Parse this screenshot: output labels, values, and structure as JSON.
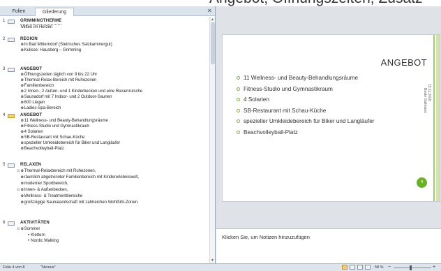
{
  "top_banner": {
    "text": "Angebot, Öffnungszeiten, Zusatz"
  },
  "left_tabs": [
    {
      "label": "Folien"
    },
    {
      "label": "Gliederung"
    }
  ],
  "outline": [
    {
      "num": "1",
      "title": "GRIMMINGTHERME",
      "lines": [
        {
          "text": "Mitten im Herzen",
          "type": "plain"
        }
      ]
    },
    {
      "num": "2",
      "title": "REGION",
      "lines": [
        {
          "text": "In Bad Mitterndorf (Steirisches Salzkammergut)",
          "type": "bullet"
        },
        {
          "text": "Kulisse: Hausberg – Grimming",
          "type": "bullet"
        }
      ]
    },
    {
      "num": "3",
      "title": "ANGEBOT",
      "lines": [
        {
          "text": "Öffnungszeiten  täglich von 9 bis 22 Uhr",
          "type": "bullet"
        },
        {
          "text": "Thermal-Relax-Bereich mit Ruhezonen",
          "type": "bullet"
        },
        {
          "text": "Familienbereich",
          "type": "bullet"
        },
        {
          "text": "2 Innen-, 2 Außen- und 1 Kinderbecken und eine Riesenrutsche",
          "type": "bullet"
        },
        {
          "text": "Saunadorf mit 7 Indoor- und 2 Outdoor-Saunen",
          "type": "bullet"
        },
        {
          "text": "600 Liegen",
          "type": "bullet"
        },
        {
          "text": "Ladies-Spa-Bereich",
          "type": "bullet"
        }
      ]
    },
    {
      "num": "4",
      "title": "ANGEBOT",
      "selected": true,
      "lines": [
        {
          "text": "11 Wellness- und Beauty-Behandlungsräume",
          "type": "bullet"
        },
        {
          "text": "Fitness-Studio und Gymnastikraum",
          "type": "bullet"
        },
        {
          "text": "4 Solarien",
          "type": "bullet"
        },
        {
          "text": "SB-Restaurant mit Schau-Küche",
          "type": "bullet"
        },
        {
          "text": "spezieller Umkleidebereich für Biker und Langläufer",
          "type": "bullet"
        },
        {
          "text": "Beachvolleyball-Platz",
          "type": "bullet"
        }
      ]
    },
    {
      "num": "5",
      "title": "RELAXEN",
      "lines": [
        {
          "text": "Thermal-Relaxbereich mit Ruhezonen,",
          "type": "bullet"
        },
        {
          "text": "räumlich abgetrennter  Familienbereich mit Kindererlebniswelt,",
          "type": "bullet"
        },
        {
          "text": "moderner Sportbereich,",
          "type": "bullet"
        },
        {
          "text": "Innen- & Außenbecken,",
          "type": "bullet"
        },
        {
          "text": "Wellness- & Treatmentbereiche",
          "type": "bullet"
        },
        {
          "text": "großzügige Saunalandschaft  mit zahlreichen Wohlfühl-Zonen.",
          "type": "bullet"
        }
      ]
    },
    {
      "num": "6",
      "title": "AKTIVITÄTEN",
      "lines": [
        {
          "text": "Sommer",
          "type": "bullet"
        },
        {
          "text": "Klettern",
          "type": "sub"
        },
        {
          "text": "Nordic Walking",
          "type": "sub"
        }
      ]
    }
  ],
  "slide": {
    "title": "ANGEBOT",
    "bullets": [
      "11 Wellness- und Beauty-Behandlungsräume",
      "Fitness-Studio und Gymnastikraum",
      "4 Solarien",
      "SB-Restaurant mit Schau-Küche",
      "spezieller Umkleidebereich für Biker und Langläufer",
      "Beachvolleyball-Platz"
    ],
    "page_number": "4",
    "side_date": "15.11.2008",
    "side_author": "Beate Gallmann",
    "accent_color": "#6cb028"
  },
  "notes": {
    "placeholder": "Klicken Sie, um Notizen hinzuzufügen"
  },
  "status": {
    "slide_info": "Folie 4 von 8",
    "theme": "\"Nereus\"",
    "zoom": "58 %",
    "zoom_minus": "−",
    "zoom_plus": "+"
  }
}
